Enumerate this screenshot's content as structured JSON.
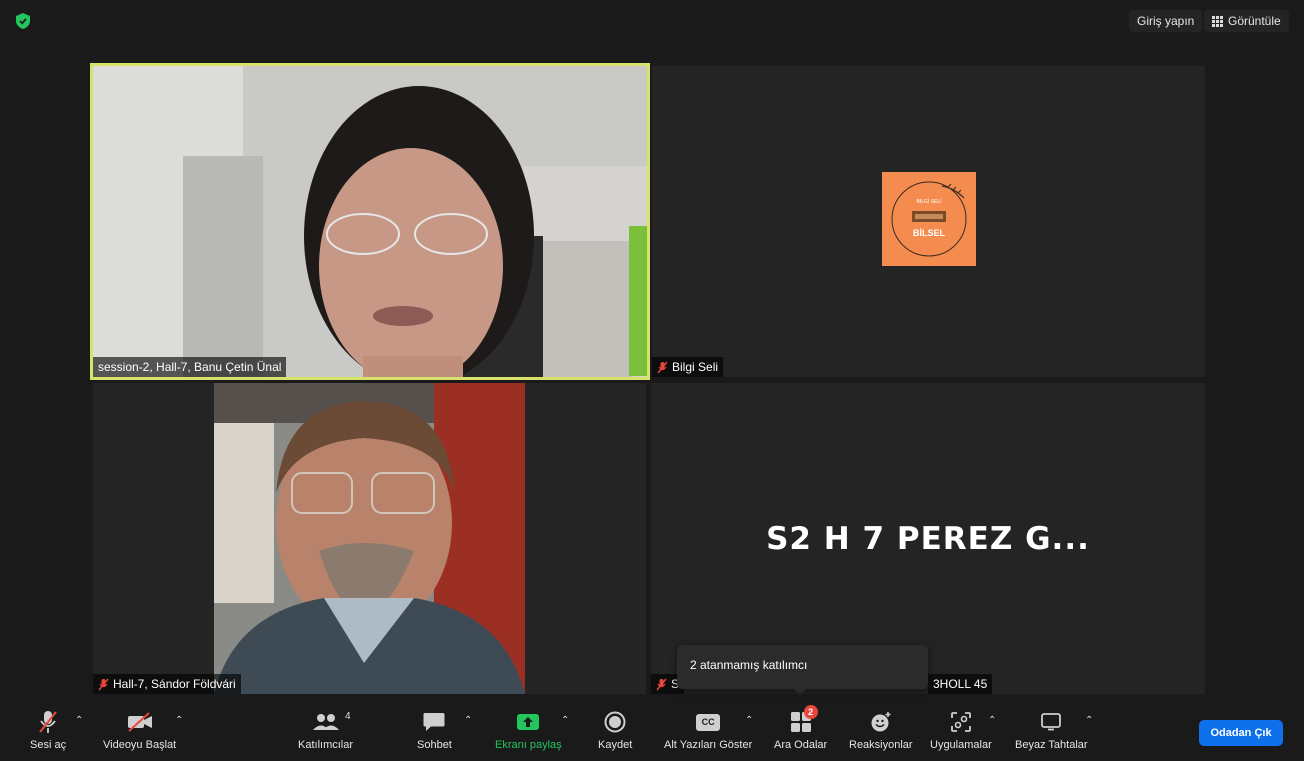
{
  "topbar": {
    "sign_in": "Giriş yapın",
    "view": "Görüntüle"
  },
  "tiles": [
    {
      "name": "session-2, Hall-7, Banu Çetin Ünal"
    },
    {
      "name": "Bilgi Seli",
      "logo_text_top": "BİLGİ SELİ",
      "logo_text": "BİLSEL"
    },
    {
      "name": "Hall-7, Sándor Földvári"
    },
    {
      "name_start": "S",
      "name_end": "3HOLL 45",
      "display_name": "S2 H 7 PEREZ G..."
    }
  ],
  "tooltip": {
    "text": "2 atanmamış katılımcı"
  },
  "toolbar": {
    "mute": "Sesi aç",
    "video": "Videoyu Başlat",
    "participants": "Katılımcılar",
    "participants_count": "4",
    "chat": "Sohbet",
    "share": "Ekranı paylaş",
    "record": "Kaydet",
    "captions": "Alt Yazıları Göster",
    "captions_icon": "CC",
    "breakout": "Ara Odalar",
    "breakout_badge": "2",
    "reactions": "Reaksiyonlar",
    "apps": "Uygulamalar",
    "whiteboards": "Beyaz Tahtalar",
    "leave": "Odadan Çık"
  },
  "colors": {
    "accent_green": "#22c55e",
    "active_speaker_border": "#d7e26a",
    "leave_blue": "#0e71eb",
    "muted_red": "#e8463f",
    "logo_orange": "#f58c4f"
  }
}
